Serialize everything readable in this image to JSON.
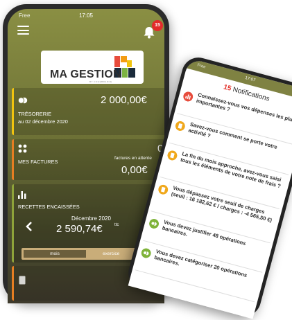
{
  "app": {
    "carrier": "Free",
    "time": "17:05",
    "notif_count": "15",
    "logo_text": "MA GESTION",
    "logo_sub": "BY COGEBRANCE"
  },
  "tresorerie": {
    "value": "2 000,00€",
    "label": "TRÉSORERIE",
    "date": "au 02 décembre 2020",
    "accent": "#f1c40f"
  },
  "factures": {
    "label": "MES FACTURES",
    "count": "0",
    "waiting_label": "factures en attente",
    "value": "0,00€",
    "accent": "#e67e22"
  },
  "recettes": {
    "label": "RECETTES ENCAISSÉES",
    "period": "Décembre 2020",
    "value": "2 590,74€",
    "suffix": "ttc",
    "toggle_mois": "mois",
    "toggle_exercice": "exercice",
    "accent": "#8ea33a"
  },
  "notifications": {
    "time": "17:07",
    "carrier": "Free",
    "count": "15",
    "title": "Notifications",
    "items": [
      {
        "text": "Connaissez-vous vos dépenses les plus importantes ?",
        "icon": "bar-chart-icon",
        "color": "#e74c3c"
      },
      {
        "text": "Savez-vous comment se porte votre activité ?",
        "icon": "document-icon",
        "color": "#f0a81c"
      },
      {
        "text": "La fin du mois approche, avez-vous saisi tous les éléments de votre note de frais ?",
        "icon": "document-icon",
        "color": "#f0a81c"
      },
      {
        "text": "Vous dépassez votre seuil de charges (seuil : 16 182,62 € / charges : -4 565,50 €)",
        "icon": "document-icon",
        "color": "#f0a81c"
      },
      {
        "text": "Vous devez justifier 48 opérations bancaires.",
        "icon": "coins-icon",
        "color": "#7fb33a"
      },
      {
        "text": "Vous devez catégoriser 20 opérations bancaires.",
        "icon": "coins-icon",
        "color": "#7fb33a"
      }
    ]
  }
}
